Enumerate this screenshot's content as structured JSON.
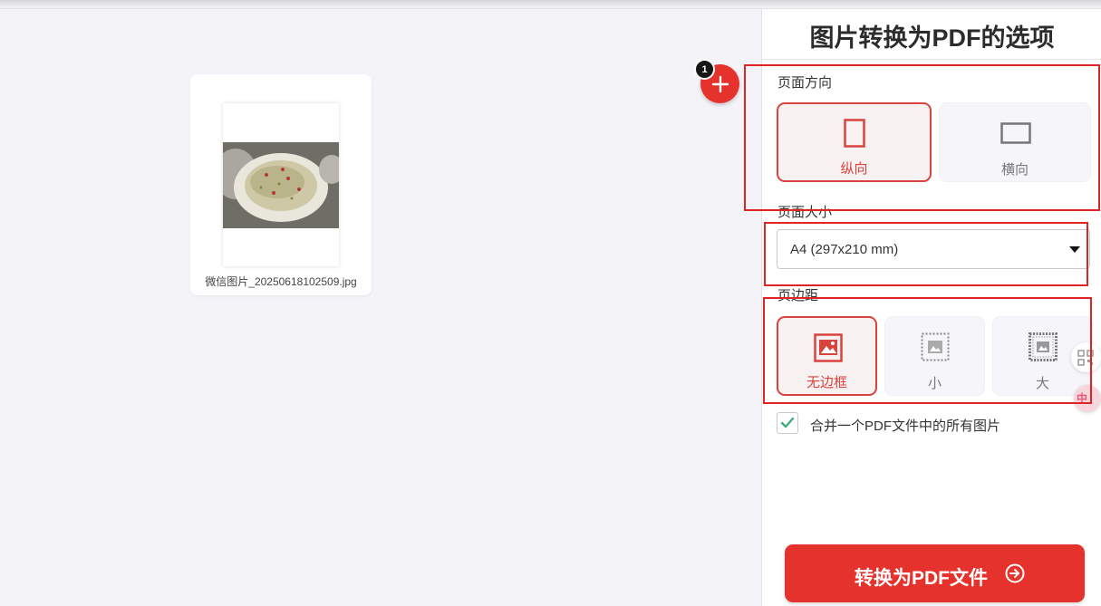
{
  "file": {
    "name": "微信图片_20250618102509.jpg"
  },
  "add_badge": "1",
  "panel": {
    "title": "图片转换为PDF的选项",
    "orientation": {
      "label": "页面方向",
      "options": [
        "纵向",
        "横向"
      ],
      "selected": "纵向"
    },
    "page_size": {
      "label": "页面大小",
      "value": "A4 (297x210 mm)"
    },
    "margin": {
      "label": "页边距",
      "options": [
        "无边框",
        "小",
        "大"
      ],
      "selected": "无边框"
    },
    "merge": {
      "label": "合并一个PDF文件中的所有图片",
      "checked": true
    },
    "convert_button": "转换为PDF文件"
  },
  "side_widget": {
    "lang_label": "中"
  },
  "colors": {
    "accent": "#e5322d",
    "selected_border": "#d8433e",
    "annotation": "#e02424",
    "checkmark": "#3fae7a"
  }
}
